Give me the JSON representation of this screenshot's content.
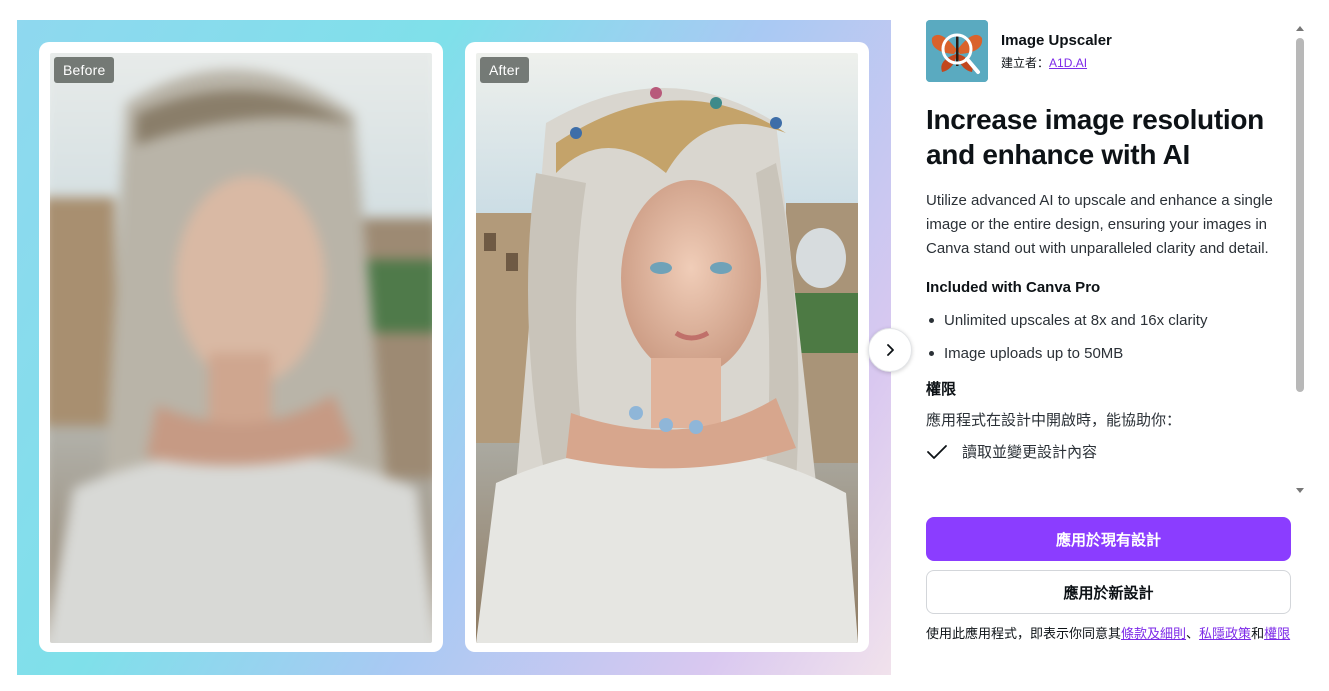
{
  "gallery": {
    "before_label": "Before",
    "after_label": "After",
    "next_icon": "chevron-right-icon"
  },
  "app": {
    "name": "Image Upscaler",
    "author_prefix": "建立者：",
    "author_link": "A1D.AI",
    "logo_icon": "butterfly-magnifier-logo"
  },
  "content": {
    "headline": "Increase image resolution and enhance with AI",
    "description": "Utilize advanced AI to upscale and enhance a single image or the entire design, ensuring your images in Canva stand out with unparalleled clarity and detail.",
    "included_title": "Included with Canva Pro",
    "included_items": [
      "Unlimited upscales at 8x and 16x clarity",
      "Image uploads up to 50MB"
    ],
    "permissions_title": "權限",
    "permissions_desc": "應用程式在設計中開啟時，能協助你：",
    "permissions_items": [
      "讀取並變更設計內容"
    ]
  },
  "actions": {
    "apply_existing": "應用於現有設計",
    "apply_new": "應用於新設計"
  },
  "terms": {
    "prefix": "使用此應用程式，即表示你同意其",
    "link_terms": "條款及細則",
    "sep": "、",
    "link_privacy": "私隱政策",
    "and": "和",
    "link_permissions": "權限"
  },
  "colors": {
    "accent": "#8b3dff",
    "link": "#7d2ae8"
  }
}
